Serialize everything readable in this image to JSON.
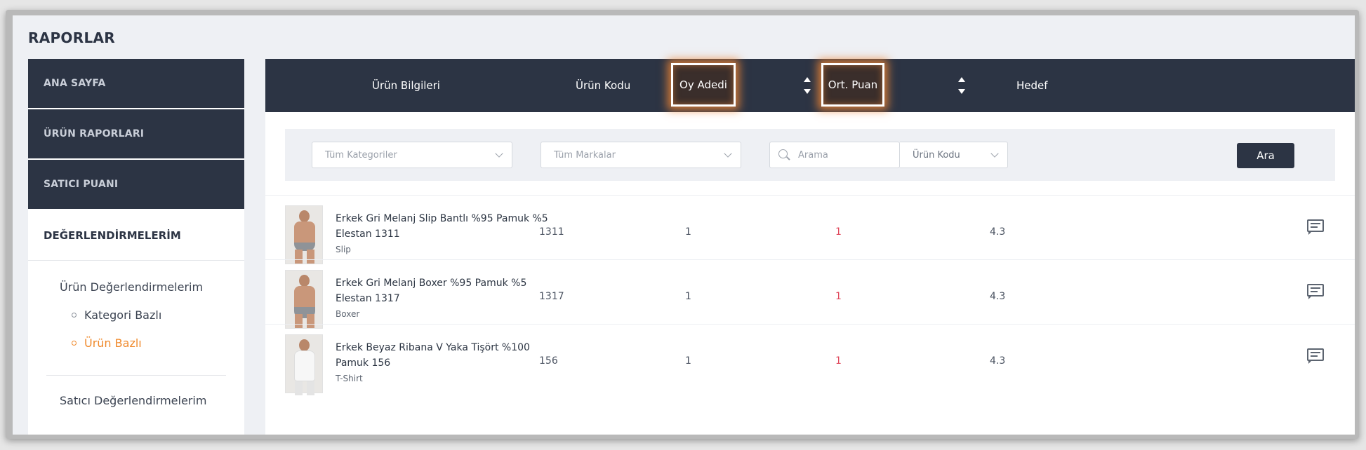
{
  "page_title": "RAPORLAR",
  "sidebar": {
    "dark_items": [
      {
        "label": "ANA SAYFA"
      },
      {
        "label": "ÜRÜN RAPORLARI"
      },
      {
        "label": "SATICI PUANI"
      }
    ],
    "active_section": "DEĞERLENDİRMELERİM",
    "sub_item_1": "Ürün Değerlendirmelerim",
    "bullets": [
      {
        "label": "Kategori Bazlı",
        "active": false
      },
      {
        "label": "Ürün Bazlı",
        "active": true
      }
    ],
    "sub_item_2": "Satıcı Değerlendirmelerim"
  },
  "table": {
    "headers": {
      "product_info": "Ürün Bilgileri",
      "product_code": "Ürün Kodu",
      "vote_count": "Oy Adedi",
      "avg_score": "Ort. Puan",
      "target": "Hedef"
    },
    "filters": {
      "category_placeholder": "Tüm Kategoriler",
      "brand_placeholder": "Tüm Markalar",
      "search_placeholder": "Arama",
      "search_type": "Ürün Kodu",
      "search_button": "Ara"
    },
    "rows": [
      {
        "name": "Erkek Gri Melanj Slip Bantlı %95 Pamuk %5 Elestan 1311",
        "category": "Slip",
        "code": "1311",
        "votes": "1",
        "avg": "1",
        "target": "4.3"
      },
      {
        "name": "Erkek Gri Melanj Boxer %95 Pamuk %5 Elestan 1317",
        "category": "Boxer",
        "code": "1317",
        "votes": "1",
        "avg": "1",
        "target": "4.3"
      },
      {
        "name": "Erkek Beyaz Ribana V Yaka Tişört %100 Pamuk 156",
        "category": "T-Shirt",
        "code": "156",
        "votes": "1",
        "avg": "1",
        "target": "4.3"
      }
    ]
  },
  "colors": {
    "dark_navy": "#2c3444",
    "accent_orange": "#f08a2c",
    "highlight_glow": "#ec8434",
    "avg_red": "#e0485c"
  },
  "icons": [
    "sort-icon",
    "search-icon",
    "chevron-down-icon",
    "comment-icon"
  ]
}
